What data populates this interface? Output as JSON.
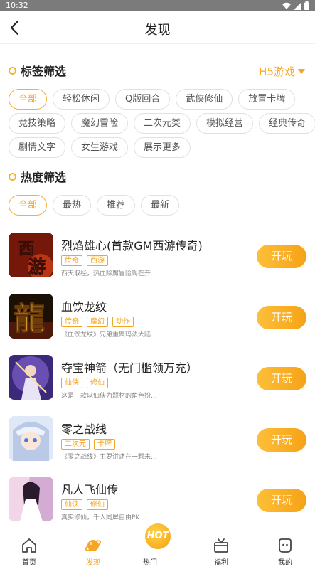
{
  "status_bar": {
    "time": "10:32"
  },
  "header": {
    "title": "发现"
  },
  "tag_filter": {
    "title": "标签筛选",
    "platform": "H5游戏",
    "rows": [
      [
        "全部",
        "轻松休闲",
        "Q版回合",
        "武侠修仙",
        "放置卡牌"
      ],
      [
        "竞技策略",
        "魔幻冒险",
        "二次元类",
        "模拟经营",
        "经典传奇"
      ],
      [
        "剧情文字",
        "女生游戏",
        "展示更多"
      ]
    ],
    "active": "全部"
  },
  "hot_filter": {
    "title": "热度筛选",
    "options": [
      "全部",
      "最热",
      "推荐",
      "最新"
    ],
    "active": "全部"
  },
  "games": [
    {
      "title": "烈焰雄心(首款GM西游传奇)",
      "tags": [
        "传奇",
        "西游"
      ],
      "desc": "西天取经，热血除魔冒险现在开...",
      "button": "开玩",
      "icon": "xiyou-game-icon"
    },
    {
      "title": "血饮龙纹",
      "tags": [
        "传奇",
        "魔幻",
        "动作"
      ],
      "desc": "《血饮龙纹》兄弟重聚玛法大陆...",
      "button": "开玩",
      "icon": "dragon-game-icon"
    },
    {
      "title": "夺宝神箭（无门槛领万充）",
      "tags": [
        "仙侠",
        "修仙"
      ],
      "desc": "这是一款以仙侠为题材的角色扮...",
      "button": "开玩",
      "icon": "archer-game-icon"
    },
    {
      "title": "零之战线",
      "tags": [
        "二次元",
        "卡牌"
      ],
      "desc": "《零之战线》主要讲述在一颗未...",
      "button": "开玩",
      "icon": "anime-game-icon"
    },
    {
      "title": "凡人飞仙传",
      "tags": [
        "仙侠",
        "修仙"
      ],
      "desc": "真实修仙，千人同屏自由PK ...",
      "button": "开玩",
      "icon": "fairy-game-icon"
    }
  ],
  "bottom_nav": {
    "items": [
      "首页",
      "发现",
      "热门",
      "福利",
      "我的"
    ],
    "active": "发现",
    "hot_badge": "HOT"
  },
  "colors": {
    "accent": "#f5a623",
    "status_bar": "#7b7b7b"
  }
}
